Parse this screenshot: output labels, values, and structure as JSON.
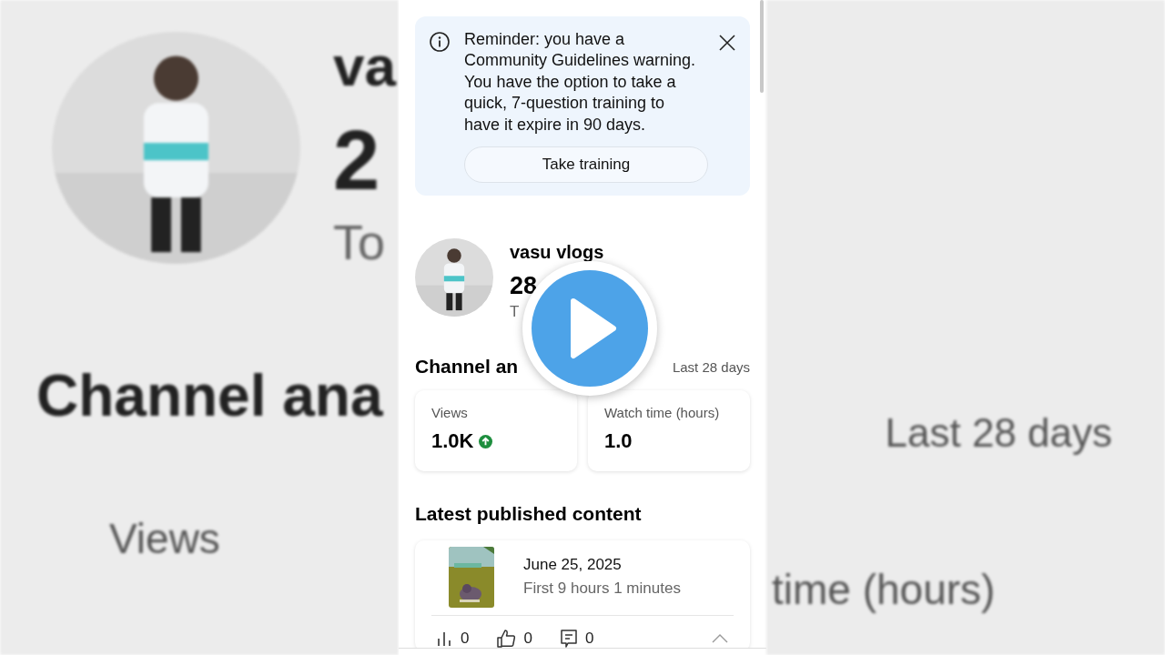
{
  "backdrop": {
    "title": "va",
    "count": "2",
    "caption": "To",
    "section": "Channel ana",
    "stat_label": "Views",
    "range": "Last 28 days",
    "stat_label_2": "time (hours)"
  },
  "notice": {
    "text": "Reminder: you have a Community Guidelines warning. You have the option to take a quick, 7-question training to have it expire in 90 days.",
    "button": "Take training"
  },
  "channel": {
    "name": "vasu vlogs",
    "count": "28",
    "caption": "T"
  },
  "analytics": {
    "title": "Channel an",
    "range": "Last 28 days",
    "stats": [
      {
        "label": "Views",
        "value": "1.0K",
        "rising": true
      },
      {
        "label": "Watch time (hours)",
        "value": "1.0",
        "rising": false
      }
    ]
  },
  "latest": {
    "title": "Latest published content",
    "items": [
      {
        "date": "June 25, 2025",
        "subtitle": "First 9 hours 1 minutes",
        "expanded": true,
        "metrics": [
          {
            "kind": "views",
            "value": "0"
          },
          {
            "kind": "likes",
            "value": "0"
          },
          {
            "kind": "comments",
            "value": "0"
          }
        ]
      }
    ]
  }
}
